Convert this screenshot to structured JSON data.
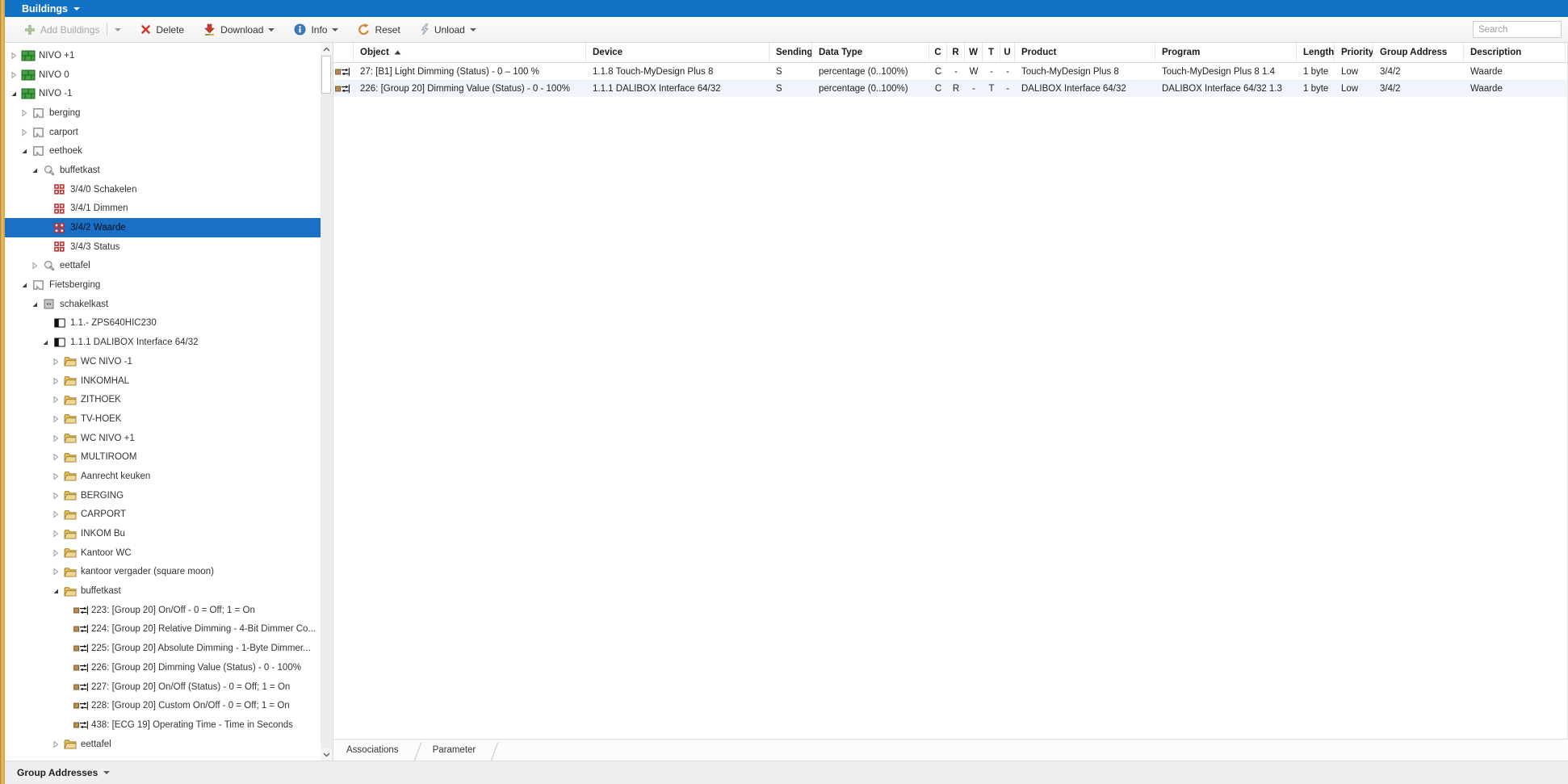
{
  "panel": {
    "title": "Buildings"
  },
  "toolbar": {
    "buttons": [
      {
        "id": "add-buildings",
        "label": "Add Buildings",
        "icon": "plus",
        "disabled": true,
        "separator": true,
        "caret": true
      },
      {
        "id": "delete",
        "label": "Delete",
        "icon": "delete",
        "disabled": false,
        "separator": false,
        "caret": false
      },
      {
        "id": "download",
        "label": "Download",
        "icon": "download",
        "disabled": false,
        "separator": false,
        "caret": true
      },
      {
        "id": "info",
        "label": "Info",
        "icon": "info",
        "disabled": false,
        "separator": false,
        "caret": true
      },
      {
        "id": "reset",
        "label": "Reset",
        "icon": "reset",
        "disabled": false,
        "separator": false,
        "caret": false
      },
      {
        "id": "unload",
        "label": "Unload",
        "icon": "unload",
        "disabled": false,
        "separator": false,
        "caret": true
      }
    ],
    "search_placeholder": "Search"
  },
  "tree": {
    "items": [
      {
        "label": "NIVO +1",
        "level": 0,
        "icon": "building",
        "expander": "closed",
        "selected": false
      },
      {
        "label": "NIVO 0",
        "level": 0,
        "icon": "building",
        "expander": "closed",
        "selected": false
      },
      {
        "label": "NIVO -1",
        "level": 0,
        "icon": "building",
        "expander": "open",
        "selected": false
      },
      {
        "label": "berging",
        "level": 1,
        "icon": "room",
        "expander": "closed",
        "selected": false
      },
      {
        "label": "carport",
        "level": 1,
        "icon": "room",
        "expander": "closed",
        "selected": false
      },
      {
        "label": "eethoek",
        "level": 1,
        "icon": "room",
        "expander": "open",
        "selected": false
      },
      {
        "label": "buffetkast",
        "level": 2,
        "icon": "light",
        "expander": "open",
        "selected": false
      },
      {
        "label": "3/4/0 Schakelen",
        "level": 3,
        "icon": "ga",
        "expander": "none",
        "selected": false
      },
      {
        "label": "3/4/1 Dimmen",
        "level": 3,
        "icon": "ga",
        "expander": "none",
        "selected": false
      },
      {
        "label": "3/4/2 Waarde",
        "level": 3,
        "icon": "ga",
        "expander": "none",
        "selected": true
      },
      {
        "label": "3/4/3 Status",
        "level": 3,
        "icon": "ga",
        "expander": "none",
        "selected": false
      },
      {
        "label": "eettafel",
        "level": 2,
        "icon": "light",
        "expander": "closed",
        "selected": false
      },
      {
        "label": "Fietsberging",
        "level": 1,
        "icon": "room",
        "expander": "open",
        "selected": false
      },
      {
        "label": "schakelkast",
        "level": 2,
        "icon": "cabinet",
        "expander": "open",
        "selected": false
      },
      {
        "label": "1.1.- ZPS640HIC230",
        "level": 3,
        "icon": "device",
        "expander": "none",
        "selected": false
      },
      {
        "label": "1.1.1 DALIBOX Interface 64/32",
        "level": 3,
        "icon": "device",
        "expander": "open",
        "selected": false
      },
      {
        "label": "WC NIVO -1",
        "level": 4,
        "icon": "folder",
        "expander": "closed",
        "selected": false
      },
      {
        "label": "INKOMHAL",
        "level": 4,
        "icon": "folder",
        "expander": "closed",
        "selected": false
      },
      {
        "label": "ZITHOEK",
        "level": 4,
        "icon": "folder",
        "expander": "closed",
        "selected": false
      },
      {
        "label": "TV-HOEK",
        "level": 4,
        "icon": "folder",
        "expander": "closed",
        "selected": false
      },
      {
        "label": "WC NIVO +1",
        "level": 4,
        "icon": "folder",
        "expander": "closed",
        "selected": false
      },
      {
        "label": "MULTIROOM",
        "level": 4,
        "icon": "folder",
        "expander": "closed",
        "selected": false
      },
      {
        "label": "Aanrecht keuken",
        "level": 4,
        "icon": "folder",
        "expander": "closed",
        "selected": false
      },
      {
        "label": "BERGING",
        "level": 4,
        "icon": "folder",
        "expander": "closed",
        "selected": false
      },
      {
        "label": "CARPORT",
        "level": 4,
        "icon": "folder",
        "expander": "closed",
        "selected": false
      },
      {
        "label": "INKOM Bu",
        "level": 4,
        "icon": "folder",
        "expander": "closed",
        "selected": false
      },
      {
        "label": "Kantoor WC",
        "level": 4,
        "icon": "folder",
        "expander": "closed",
        "selected": false
      },
      {
        "label": "kantoor vergader (square moon)",
        "level": 4,
        "icon": "folder",
        "expander": "closed",
        "selected": false
      },
      {
        "label": "buffetkast",
        "level": 4,
        "icon": "folder",
        "expander": "open",
        "selected": false
      },
      {
        "label": "223: [Group 20] On/Off  - 0 = Off; 1 = On",
        "level": 5,
        "icon": "object",
        "expander": "none",
        "selected": false
      },
      {
        "label": "224: [Group 20] Relative Dimming - 4-Bit Dimmer Co...",
        "level": 5,
        "icon": "object",
        "expander": "none",
        "selected": false
      },
      {
        "label": "225: [Group 20] Absolute Dimming - 1-Byte Dimmer...",
        "level": 5,
        "icon": "object",
        "expander": "none",
        "selected": false
      },
      {
        "label": "226: [Group 20] Dimming Value (Status) - 0 - 100%",
        "level": 5,
        "icon": "object",
        "expander": "none",
        "selected": false
      },
      {
        "label": "227: [Group 20] On/Off (Status) - 0 = Off; 1 = On",
        "level": 5,
        "icon": "object",
        "expander": "none",
        "selected": false
      },
      {
        "label": "228: [Group 20] Custom On/Off - 0 = Off; 1 = On",
        "level": 5,
        "icon": "object",
        "expander": "none",
        "selected": false
      },
      {
        "label": "438: [ECG 19] Operating Time - Time in Seconds",
        "level": 5,
        "icon": "object",
        "expander": "none",
        "selected": false
      },
      {
        "label": "eettafel",
        "level": 4,
        "icon": "folder",
        "expander": "closed",
        "selected": false
      }
    ]
  },
  "table": {
    "columns": [
      "",
      "Object",
      "Device",
      "Sending",
      "Data Type",
      "C",
      "R",
      "W",
      "T",
      "U",
      "Product",
      "Program",
      "Length",
      "Priority",
      "Group Address",
      "Description"
    ],
    "sorted_column": "Object",
    "sort_direction": "asc",
    "rows": [
      {
        "object": "27: [B1] Light Dimming (Status) - 0 – 100 %",
        "device": "1.1.8 Touch-MyDesign Plus 8",
        "sending": "S",
        "data_type": "percentage (0..100%)",
        "flags": {
          "c": "C",
          "r": "-",
          "w": "W",
          "t": "-",
          "u": "-"
        },
        "product": "Touch-MyDesign Plus 8",
        "program": "Touch-MyDesign Plus 8 1.4",
        "length": "1 byte",
        "priority": "Low",
        "group_address": "3/4/2",
        "description": "Waarde"
      },
      {
        "object": "226: [Group 20] Dimming Value (Status) - 0 - 100%",
        "device": "1.1.1 DALIBOX Interface 64/32",
        "sending": "S",
        "data_type": "percentage (0..100%)",
        "flags": {
          "c": "C",
          "r": "R",
          "w": "-",
          "t": "T",
          "u": "-"
        },
        "product": "DALIBOX Interface 64/32",
        "program": "DALIBOX Interface 64/32 1.3",
        "length": "1 byte",
        "priority": "Low",
        "group_address": "3/4/2",
        "description": "Waarde"
      }
    ]
  },
  "tabs": {
    "items": [
      "Associations",
      "Parameter"
    ]
  },
  "bottom_panel": {
    "title": "Group Addresses"
  },
  "colors": {
    "accent_blue": "#1273C6",
    "selection_blue": "#1B6FC5",
    "row_alt": "#EFF5FB",
    "bottombar_bg": "#EFEFEF",
    "gold_strip": "#CE9C42",
    "ga_red": "#C43030",
    "folder_yellow": "#E3BC5D",
    "building_green": "#44A244",
    "comm_object_tan": "#BE8A4D"
  }
}
